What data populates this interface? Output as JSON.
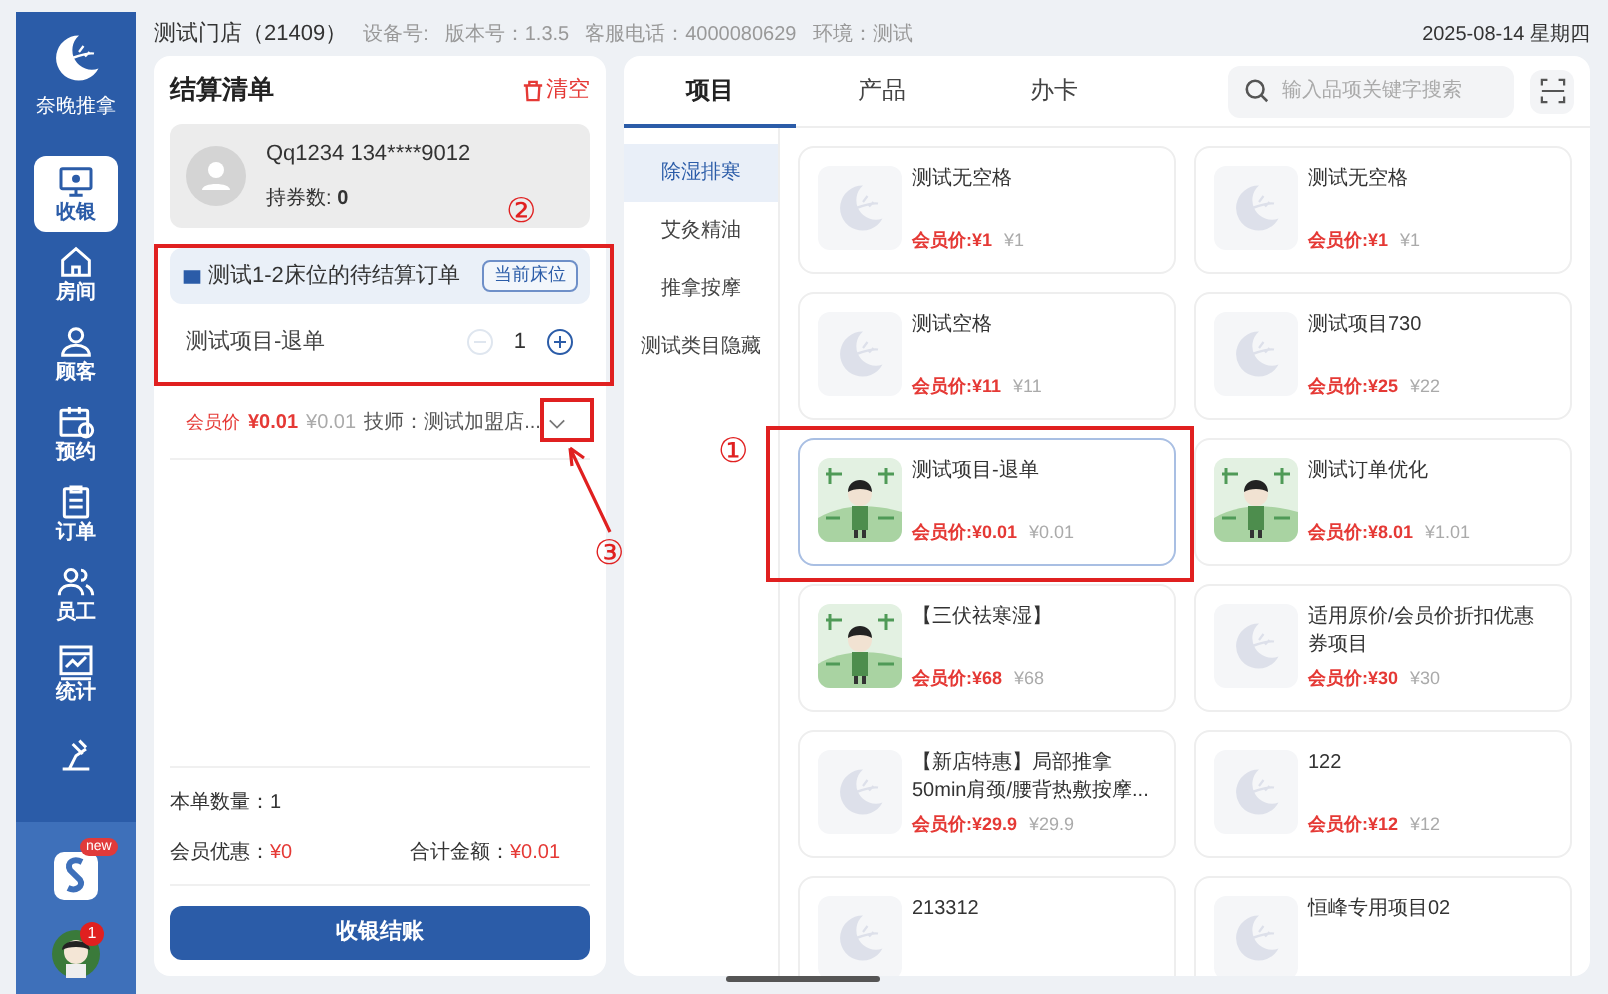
{
  "sidebar": {
    "logo_text": "奈晚推拿",
    "items": [
      {
        "label": "收银",
        "selected": true
      },
      {
        "label": "房间",
        "selected": false
      },
      {
        "label": "顾客",
        "selected": false
      },
      {
        "label": "预约",
        "selected": false
      },
      {
        "label": "订单",
        "selected": false
      },
      {
        "label": "员工",
        "selected": false
      },
      {
        "label": "统计",
        "selected": false
      },
      {
        "selected": false
      }
    ],
    "app_badge": "new",
    "avatar_badge": "1"
  },
  "header": {
    "store": "测试门店（21409）",
    "device": "设备号:",
    "version": "版本号：1.3.5",
    "phone": "客服电话：4000080629",
    "env": "环境：测试",
    "date": "2025-08-14 星期四"
  },
  "checkout": {
    "title": "结算清单",
    "clear": "清空",
    "member": {
      "name": "Qq1234 134****9012",
      "coupons": "持券数: **0**"
    },
    "order": {
      "title": "测试1-2床位的待结算订单",
      "bed_button": "当前床位",
      "items": [
        {
          "name": "测试项目-退单",
          "qty": "1",
          "minus_disabled": true,
          "price_label": "会员价",
          "member_price": "¥0.01",
          "price": "¥0.01",
          "tech": "技师：测试加盟店..."
        }
      ]
    },
    "count": "本单数量：1",
    "discount_label": "会员优惠：",
    "discount": "¥0",
    "total_label": "合计金额：",
    "total": "¥0.01",
    "submit": "收银结账"
  },
  "catalog": {
    "tabs": [
      {
        "label": "项目",
        "selected": true
      },
      {
        "label": "产品",
        "selected": false
      },
      {
        "label": "办卡",
        "selected": false
      }
    ],
    "search": {
      "placeholder": "输入品项关键字搜索"
    },
    "categories": [
      {
        "label": "除湿排寒",
        "selected": true
      },
      {
        "label": "艾灸精油",
        "selected": false
      },
      {
        "label": "推拿按摩",
        "selected": false
      },
      {
        "label": "测试类目隐藏",
        "selected": false
      }
    ],
    "items": [
      {
        "name": "测试无空格",
        "kind": "placeholder",
        "member_price": "会员价:¥1",
        "price": "¥1",
        "selected": false
      },
      {
        "name": "测试无空格",
        "kind": "placeholder",
        "member_price": "会员价:¥1",
        "price": "¥1",
        "selected": false
      },
      {
        "name": "测试空格",
        "kind": "placeholder",
        "member_price": "会员价:¥11",
        "price": "¥11",
        "selected": false
      },
      {
        "name": "测试项目730",
        "kind": "placeholder",
        "member_price": "会员价:¥25",
        "price": "¥22",
        "selected": false
      },
      {
        "name": "测试项目-退单",
        "kind": "picture",
        "member_price": "会员价:¥0.01",
        "price": "¥0.01",
        "selected": true
      },
      {
        "name": "测试订单优化",
        "kind": "picture",
        "member_price": "会员价:¥8.01",
        "price": "¥1.01",
        "selected": false
      },
      {
        "name": "【三伏祛寒湿】",
        "kind": "picture",
        "member_price": "会员价:¥68",
        "price": "¥68",
        "selected": false
      },
      {
        "name": "适用原价/会员价折扣优惠券项目",
        "kind": "placeholder",
        "member_price": "会员价:¥30",
        "price": "¥30",
        "selected": false
      },
      {
        "name": "【新店特惠】局部推拿50min肩颈/腰背热敷按摩...",
        "kind": "placeholder",
        "member_price": "会员价:¥29.9",
        "price": "¥29.9",
        "selected": false
      },
      {
        "name": "122",
        "kind": "placeholder",
        "member_price": "会员价:¥12",
        "price": "¥12",
        "selected": false
      },
      {
        "name": "213312",
        "kind": "placeholder",
        "selected": false
      },
      {
        "name": "恒峰专用项目02",
        "kind": "placeholder",
        "selected": false
      }
    ]
  },
  "annotations": [
    "①",
    "②",
    "③"
  ]
}
